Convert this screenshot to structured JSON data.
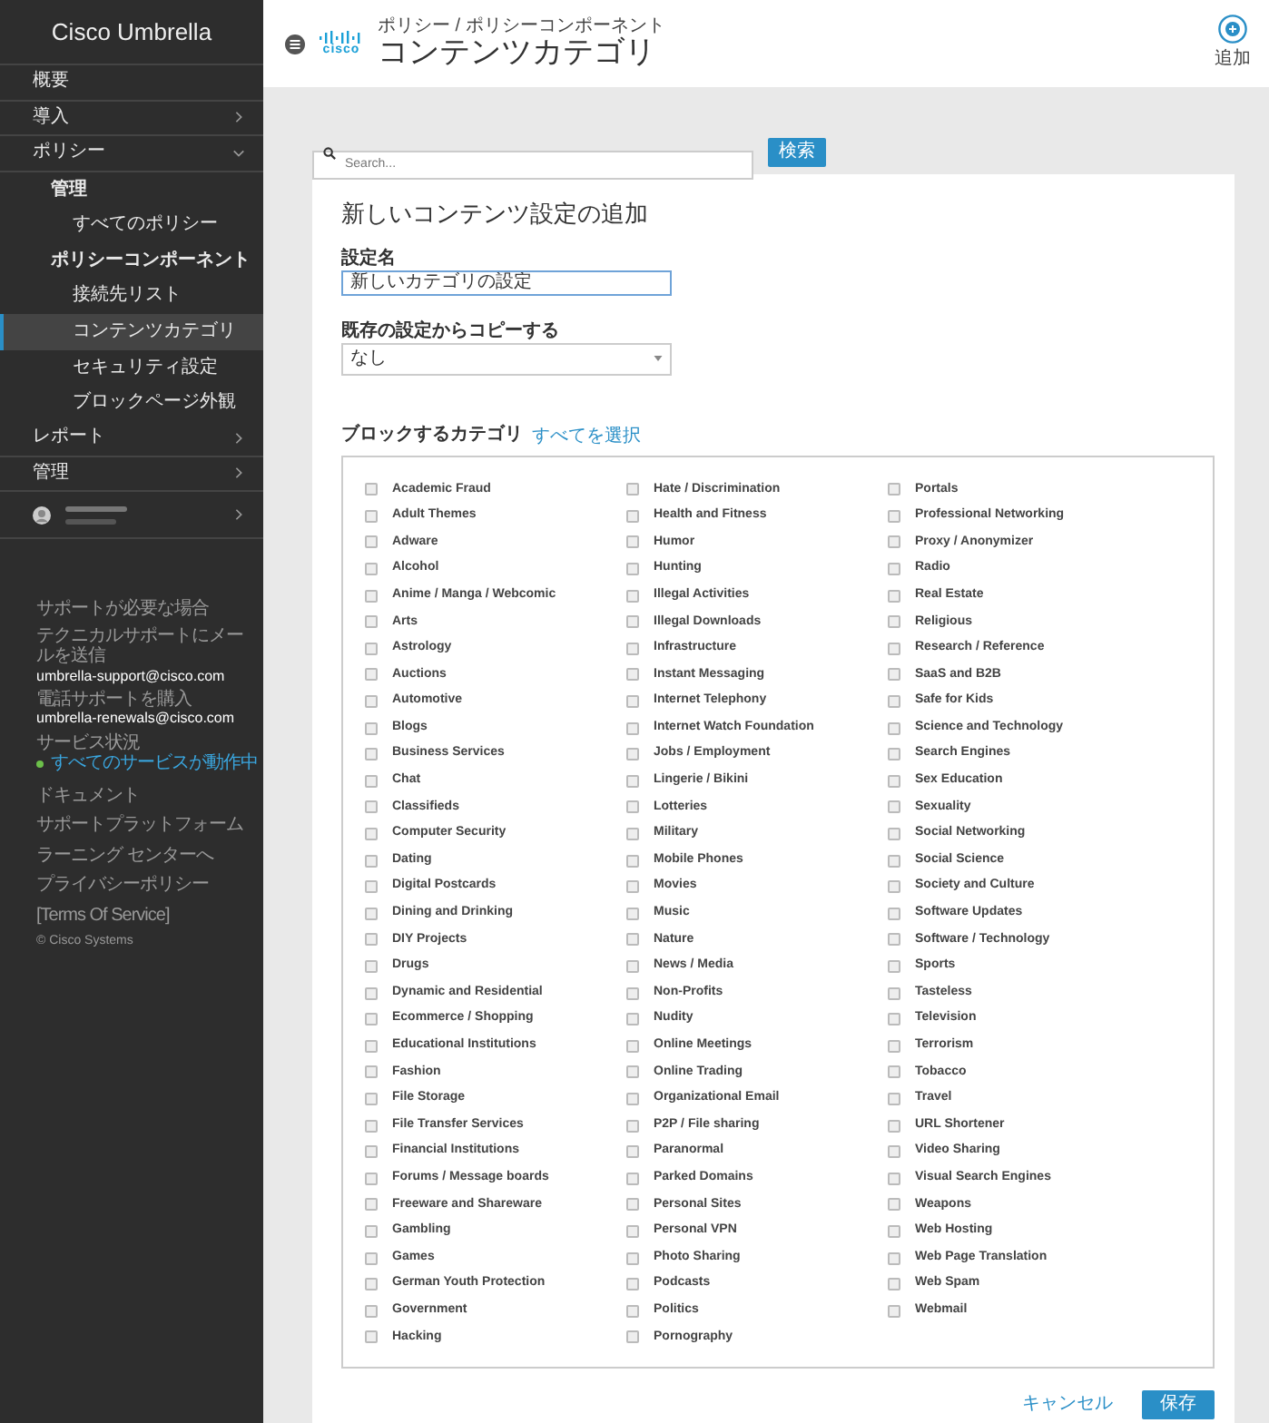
{
  "sidebar": {
    "brand": "Cisco Umbrella",
    "items": [
      {
        "label": "概要",
        "kind": "section",
        "selected": false
      },
      {
        "label": "導入",
        "kind": "section",
        "selected": false,
        "expanded": false
      },
      {
        "label": "ポリシー",
        "kind": "section",
        "selected": false,
        "expanded": true,
        "children": [
          {
            "label": "管理",
            "kind": "group",
            "selected": false,
            "children": [
              {
                "label": "すべてのポリシー",
                "kind": "item",
                "selected": false
              }
            ]
          },
          {
            "label": "ポリシーコンポーネント",
            "kind": "group",
            "selected": false,
            "children": [
              {
                "label": "接続先リスト",
                "kind": "item",
                "selected": false
              },
              {
                "label": "コンテンツカテゴリ",
                "kind": "item",
                "selected": true
              },
              {
                "label": "セキュリティ設定",
                "kind": "item",
                "selected": false
              },
              {
                "label": "ブロックページ外観",
                "kind": "item",
                "selected": false
              }
            ]
          }
        ]
      },
      {
        "label": "レポート",
        "kind": "section",
        "selected": false,
        "expanded": false
      },
      {
        "label": "管理",
        "kind": "section",
        "selected": false,
        "expanded": false
      },
      {
        "kind": "user",
        "selected": false,
        "expanded": false
      }
    ],
    "support": [
      {
        "text": "サポートが必要な場合",
        "kind": "label"
      },
      {
        "text": "テクニカルサポートにメールを送信",
        "kind": "label"
      },
      {
        "text": "umbrella-support@cisco.com",
        "kind": "email"
      },
      {
        "text": "電話サポートを購入",
        "kind": "label"
      },
      {
        "text": "umbrella-renewals@cisco.com",
        "kind": "email"
      },
      {
        "text": "サービス状況",
        "kind": "label"
      },
      {
        "text": "すべてのサービスが動作中",
        "kind": "status",
        "color": "#6cc04a"
      }
    ],
    "links": [
      "ドキュメント",
      "サポートプラットフォーム",
      "ラーニング センターへ",
      "プライバシーポリシー",
      "[Terms Of Service]",
      "© Cisco Systems"
    ]
  },
  "header": {
    "logo_text": "cisco",
    "breadcrumb": "ポリシー / ポリシーコンポーネント",
    "title": "コンテンツカテゴリ",
    "add_label": "追加"
  },
  "search": {
    "placeholder": "Search...",
    "button": "検索"
  },
  "form": {
    "title": "新しいコンテンツ設定の追加",
    "name_label": "設定名",
    "name_value": "新しいカテゴリの設定",
    "copy_label": "既存の設定からコピーする",
    "copy_value": "なし",
    "categories_label": "ブロックするカテゴリ",
    "select_all": "すべてを選択",
    "category_columns": [
      [
        {
          "label": "Academic Fraud",
          "checked": false
        },
        {
          "label": "Adult Themes",
          "checked": false
        },
        {
          "label": "Adware",
          "checked": false
        },
        {
          "label": "Alcohol",
          "checked": false
        },
        {
          "label": "Anime / Manga / Webcomic",
          "checked": false
        },
        {
          "label": "Arts",
          "checked": false
        },
        {
          "label": "Astrology",
          "checked": false
        },
        {
          "label": "Auctions",
          "checked": false
        },
        {
          "label": "Automotive",
          "checked": false
        },
        {
          "label": "Blogs",
          "checked": false
        },
        {
          "label": "Business Services",
          "checked": false
        },
        {
          "label": "Chat",
          "checked": false
        },
        {
          "label": "Classifieds",
          "checked": false
        },
        {
          "label": "Computer Security",
          "checked": false
        },
        {
          "label": "Dating",
          "checked": false
        },
        {
          "label": "Digital Postcards",
          "checked": false
        },
        {
          "label": "Dining and Drinking",
          "checked": false
        },
        {
          "label": "DIY Projects",
          "checked": false
        },
        {
          "label": "Drugs",
          "checked": false
        },
        {
          "label": "Dynamic and Residential",
          "checked": false
        },
        {
          "label": "Ecommerce / Shopping",
          "checked": false
        },
        {
          "label": "Educational Institutions",
          "checked": false
        },
        {
          "label": "Fashion",
          "checked": false
        },
        {
          "label": "File Storage",
          "checked": false
        },
        {
          "label": "File Transfer Services",
          "checked": false
        },
        {
          "label": "Financial Institutions",
          "checked": false
        },
        {
          "label": "Forums / Message boards",
          "checked": false
        },
        {
          "label": "Freeware and Shareware",
          "checked": false
        },
        {
          "label": "Gambling",
          "checked": false
        },
        {
          "label": "Games",
          "checked": false
        },
        {
          "label": "German Youth Protection",
          "checked": false
        },
        {
          "label": "Government",
          "checked": false
        },
        {
          "label": "Hacking",
          "checked": false
        }
      ],
      [
        {
          "label": "Hate / Discrimination",
          "checked": false
        },
        {
          "label": "Health and Fitness",
          "checked": false
        },
        {
          "label": "Humor",
          "checked": false
        },
        {
          "label": "Hunting",
          "checked": false
        },
        {
          "label": "Illegal Activities",
          "checked": false
        },
        {
          "label": "Illegal Downloads",
          "checked": false
        },
        {
          "label": "Infrastructure",
          "checked": false
        },
        {
          "label": "Instant Messaging",
          "checked": false
        },
        {
          "label": "Internet Telephony",
          "checked": false
        },
        {
          "label": "Internet Watch Foundation",
          "checked": false
        },
        {
          "label": "Jobs / Employment",
          "checked": false
        },
        {
          "label": "Lingerie / Bikini",
          "checked": false
        },
        {
          "label": "Lotteries",
          "checked": false
        },
        {
          "label": "Military",
          "checked": false
        },
        {
          "label": "Mobile Phones",
          "checked": false
        },
        {
          "label": "Movies",
          "checked": false
        },
        {
          "label": "Music",
          "checked": false
        },
        {
          "label": "Nature",
          "checked": false
        },
        {
          "label": "News / Media",
          "checked": false
        },
        {
          "label": "Non-Profits",
          "checked": false
        },
        {
          "label": "Nudity",
          "checked": false
        },
        {
          "label": "Online Meetings",
          "checked": false
        },
        {
          "label": "Online Trading",
          "checked": false
        },
        {
          "label": "Organizational Email",
          "checked": false
        },
        {
          "label": "P2P / File sharing",
          "checked": false
        },
        {
          "label": "Paranormal",
          "checked": false
        },
        {
          "label": "Parked Domains",
          "checked": false
        },
        {
          "label": "Personal Sites",
          "checked": false
        },
        {
          "label": "Personal VPN",
          "checked": false
        },
        {
          "label": "Photo Sharing",
          "checked": false
        },
        {
          "label": "Podcasts",
          "checked": false
        },
        {
          "label": "Politics",
          "checked": false
        },
        {
          "label": "Pornography",
          "checked": false
        }
      ],
      [
        {
          "label": "Portals",
          "checked": false
        },
        {
          "label": "Professional Networking",
          "checked": false
        },
        {
          "label": "Proxy / Anonymizer",
          "checked": false
        },
        {
          "label": "Radio",
          "checked": false
        },
        {
          "label": "Real Estate",
          "checked": false
        },
        {
          "label": "Religious",
          "checked": false
        },
        {
          "label": "Research / Reference",
          "checked": false
        },
        {
          "label": "SaaS and B2B",
          "checked": false
        },
        {
          "label": "Safe for Kids",
          "checked": false
        },
        {
          "label": "Science and Technology",
          "checked": false
        },
        {
          "label": "Search Engines",
          "checked": false
        },
        {
          "label": "Sex Education",
          "checked": false
        },
        {
          "label": "Sexuality",
          "checked": false
        },
        {
          "label": "Social Networking",
          "checked": false
        },
        {
          "label": "Social Science",
          "checked": false
        },
        {
          "label": "Society and Culture",
          "checked": false
        },
        {
          "label": "Software Updates",
          "checked": false
        },
        {
          "label": "Software / Technology",
          "checked": false
        },
        {
          "label": "Sports",
          "checked": false
        },
        {
          "label": "Tasteless",
          "checked": false
        },
        {
          "label": "Television",
          "checked": false
        },
        {
          "label": "Terrorism",
          "checked": false
        },
        {
          "label": "Tobacco",
          "checked": false
        },
        {
          "label": "Travel",
          "checked": false
        },
        {
          "label": "URL Shortener",
          "checked": false
        },
        {
          "label": "Video Sharing",
          "checked": false
        },
        {
          "label": "Visual Search Engines",
          "checked": false
        },
        {
          "label": "Weapons",
          "checked": false
        },
        {
          "label": "Web Hosting",
          "checked": false
        },
        {
          "label": "Web Page Translation",
          "checked": false
        },
        {
          "label": "Web Spam",
          "checked": false
        },
        {
          "label": "Webmail",
          "checked": false
        }
      ]
    ],
    "cancel": "キャンセル",
    "save": "保存"
  }
}
